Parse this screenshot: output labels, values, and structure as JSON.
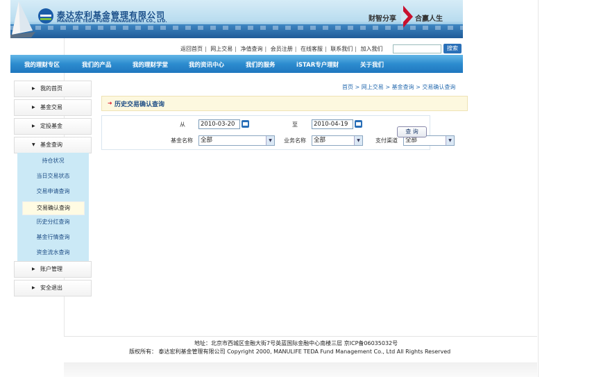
{
  "header": {
    "company_cn": "泰达宏利基金管理有限公司",
    "company_en": "MANULIFE TEDA FUND MANAGEMENT CO., LTD.",
    "slogan_left": "财智分享",
    "slogan_right": "合赢人生"
  },
  "toplinks": [
    "返回首页",
    "网上交易",
    "净值查询",
    "会员注册",
    "在线客服",
    "联系我们",
    "加入我们"
  ],
  "search": {
    "button_label": "搜索",
    "value": ""
  },
  "nav": [
    "我的理财专区",
    "我们的产品",
    "我的理财学堂",
    "我的资讯中心",
    "我们的服务",
    "iSTAR专户理财",
    "关于我们"
  ],
  "sidebar": {
    "items": [
      {
        "label": "我的首页",
        "arrow": "▶"
      },
      {
        "label": "基金交易",
        "arrow": "▶"
      },
      {
        "label": "定投基金",
        "arrow": "▶"
      },
      {
        "label": "基金查询",
        "arrow": "▼"
      },
      {
        "label": "账户管理",
        "arrow": "▶"
      },
      {
        "label": "安全退出",
        "arrow": "▶"
      }
    ],
    "subitems": [
      "持仓状况",
      "当日交易状态",
      "交易申请查询",
      "交易确认查询",
      "历史分红查询",
      "基金行情查询",
      "资金流水查询"
    ],
    "active_subitem": "交易确认查询"
  },
  "breadcrumb": [
    "首页",
    "网上交易",
    "基金查询",
    "交易确认查询"
  ],
  "breadcrumb_sep": ">",
  "page_title": "历史交易确认查询",
  "form": {
    "from_label": "从",
    "from_value": "2010-03-20",
    "to_label": "至",
    "to_value": "2010-04-19",
    "fund_label": "基金名称",
    "fund_value": "全部",
    "biz_label": "业务名称",
    "biz_value": "全部",
    "pay_label": "支付渠道",
    "pay_value": "全部",
    "query_label": "查 询"
  },
  "footer": {
    "address": "地址：北京市西城区金融大街7号英蓝国际金融中心南楼三层  京ICP备06035032号",
    "copyright": "版权所有：  泰达宏利基金管理有限公司  Copyright 2000, MANULIFE TEDA Fund Management Co., Ltd All Rights Reserved"
  },
  "colors": {
    "accent": "#2d8ccf",
    "link": "#2a6db0",
    "slogan_red": "#c8102e",
    "sub_panel": "#cbe9f6"
  }
}
